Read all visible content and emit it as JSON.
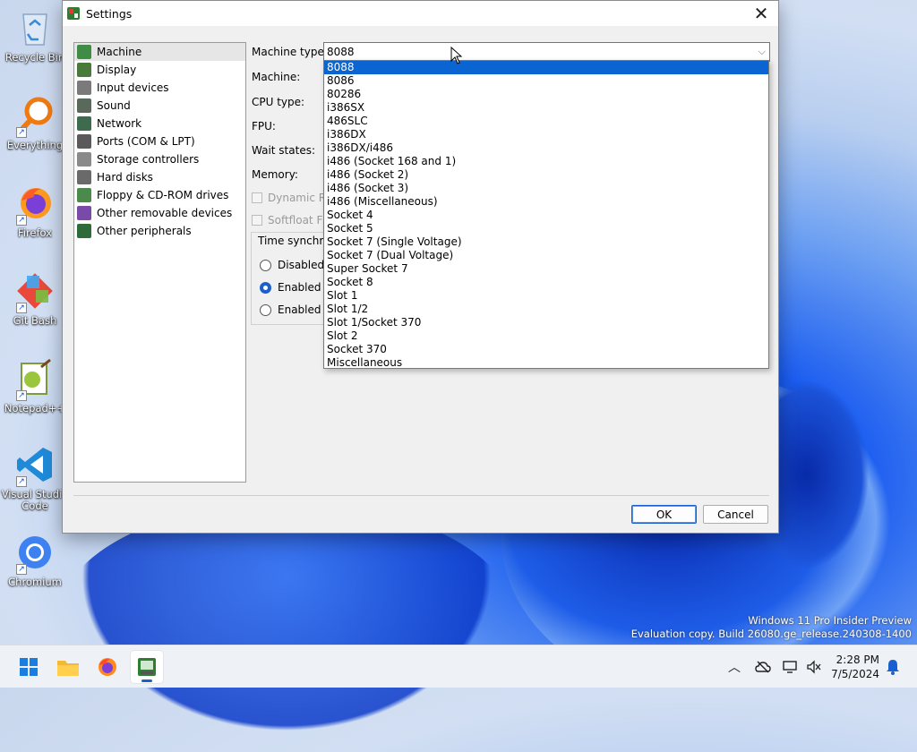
{
  "desktop": {
    "icons": [
      {
        "label": "Recycle Bin",
        "icon": "recycle-bin-icon"
      },
      {
        "label": "Everything",
        "icon": "search-magnifier-icon"
      },
      {
        "label": "Firefox",
        "icon": "firefox-icon"
      },
      {
        "label": "Git Bash",
        "icon": "git-icon"
      },
      {
        "label": "Notepad++",
        "icon": "notepad-plus-plus-icon"
      },
      {
        "label": "Visual Studio Code",
        "icon": "vscode-icon"
      },
      {
        "label": "Chromium",
        "icon": "chromium-icon"
      }
    ],
    "watermark": {
      "line1": "Windows 11 Pro Insider Preview",
      "line2": "Evaluation copy. Build 26080.ge_release.240308-1400"
    }
  },
  "window": {
    "title": "Settings",
    "nav": [
      {
        "label": "Machine",
        "selected": true
      },
      {
        "label": "Display"
      },
      {
        "label": "Input devices"
      },
      {
        "label": "Sound"
      },
      {
        "label": "Network"
      },
      {
        "label": "Ports (COM & LPT)"
      },
      {
        "label": "Storage controllers"
      },
      {
        "label": "Hard disks"
      },
      {
        "label": "Floppy & CD-ROM drives"
      },
      {
        "label": "Other removable devices"
      },
      {
        "label": "Other peripherals"
      }
    ],
    "form": {
      "machine_type_label": "Machine type:",
      "machine_type_value": "8088",
      "machine_label": "Machine:",
      "cpu_type_label": "CPU type:",
      "fpu_label": "FPU:",
      "wait_states_label": "Wait states:",
      "memory_label": "Memory:",
      "dynamic_label": "Dynamic Re",
      "softfloat_label": "Softfloat FPU",
      "time_sync_title": "Time synchro",
      "radio_disabled": "Disabled",
      "radio_enabled_1": "Enabled (l",
      "radio_enabled_2": "Enabled (U"
    },
    "dropdown_options": [
      "8088",
      "8086",
      "80286",
      "i386SX",
      "486SLC",
      "i386DX",
      "i386DX/i486",
      "i486 (Socket 168 and 1)",
      "i486 (Socket 2)",
      "i486 (Socket 3)",
      "i486 (Miscellaneous)",
      "Socket 4",
      "Socket 5",
      "Socket 7 (Single Voltage)",
      "Socket 7 (Dual Voltage)",
      "Super Socket 7",
      "Socket 8",
      "Slot 1",
      "Slot 1/2",
      "Slot 1/Socket 370",
      "Slot 2",
      "Socket 370",
      "Miscellaneous"
    ],
    "dropdown_selected_index": 0,
    "buttons": {
      "ok": "OK",
      "cancel": "Cancel"
    }
  },
  "taskbar": {
    "time": "2:28 PM",
    "date": "7/5/2024"
  },
  "colors": {
    "accent": "#0a64d2",
    "window_bg": "#f0f0f0"
  }
}
